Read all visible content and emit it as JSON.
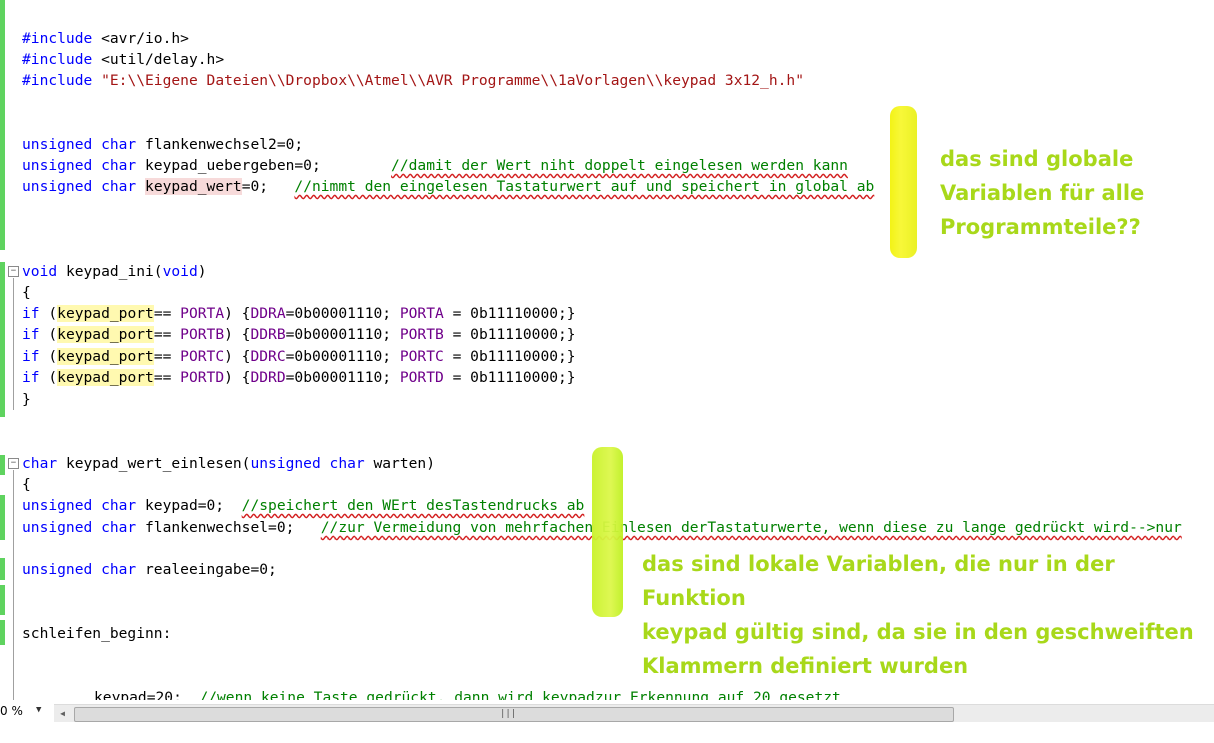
{
  "code": {
    "include1": {
      "directive": "#include",
      "path": "<avr/io.h>"
    },
    "include2": {
      "directive": "#include",
      "path": "<util/delay.h>"
    },
    "include3": {
      "directive": "#include",
      "path": "\"E:\\\\Eigene Dateien\\\\Dropbox\\\\Atmel\\\\AVR Programme\\\\1aVorlagen\\\\keypad 3x12_h.h\""
    },
    "global1": {
      "type": "unsigned char",
      "rest": " flankenwechsel2=0;"
    },
    "global2": {
      "type": "unsigned char",
      "rest": " keypad_uebergeben=0;        ",
      "comment": "//damit der Wert niht doppelt eingelesen werden kann"
    },
    "global3": {
      "type": "unsigned char",
      "name": "keypad_wert",
      "rest": "=0;   ",
      "comment": "//nimmt den eingelesen Tastaturwert auf und speichert in global ab"
    },
    "func1_sig": {
      "kw": "void",
      "name": " keypad_ini(",
      "kw2": "void",
      "close": ")"
    },
    "open_brace": "{",
    "close_brace": "}",
    "if_kw": "if",
    "keypad_port": "keypad_port",
    "ports": [
      {
        "port": "PORTA",
        "ddr": "DDRA",
        "ddrval": "=0b00001110; ",
        "val": " = 0b11110000;}"
      },
      {
        "port": "PORTB",
        "ddr": "DDRB",
        "ddrval": "=0b00001110; ",
        "val": " = 0b11110000;}"
      },
      {
        "port": "PORTC",
        "ddr": "DDRC",
        "ddrval": "=0b00001110; ",
        "val": " = 0b11110000;}"
      },
      {
        "port": "PORTD",
        "ddr": "DDRD",
        "ddrval": "=0b00001110; ",
        "val": " = 0b11110000;}"
      }
    ],
    "func2_sig": {
      "kw": "char",
      "name": " keypad_wert_einlesen(",
      "kw2": "unsigned",
      "kw3": "char",
      "close": " warten)"
    },
    "local1": {
      "type": "unsigned char",
      "rest": " keypad=0;  ",
      "comment": "//speichert den WErt desTastendrucks ab"
    },
    "local2": {
      "type": "unsigned char",
      "rest": " flankenwechsel=0;   ",
      "comment": "//zur Vermeidung von mehrfachen Einlesen derTastaturwerte, wenn diese zu lange gedrückt wird-->nur"
    },
    "local3": {
      "type": "unsigned char",
      "rest": " realeeingabe=0;"
    },
    "label": "schleifen_beginn:",
    "last_line": {
      "code": "keypad=20;  ",
      "comment": "//wenn keine Taste gedrückt, dann wird keypadzur Erkennung auf 20 gesetzt"
    }
  },
  "annotations": {
    "global_note": [
      "das sind globale",
      "Variablen für alle",
      "Programmteile??"
    ],
    "local_note": [
      "das sind lokale Variablen, die nur in der Funktion",
      "keypad gültig sind, da sie in den geschweiften",
      "Klammern definiert wurden"
    ]
  },
  "statusbar": {
    "zoom": "0 %",
    "zoom_dropdown": "▼",
    "scroll_left": "◀",
    "grip": "|||"
  },
  "colors": {
    "keyword": "#0000ff",
    "string": "#a31515",
    "comment": "#008000",
    "macro": "#6f008a",
    "annotation": "#a8d81a",
    "highlighter": "#f2f20a",
    "change_bar": "#5fd35f"
  }
}
